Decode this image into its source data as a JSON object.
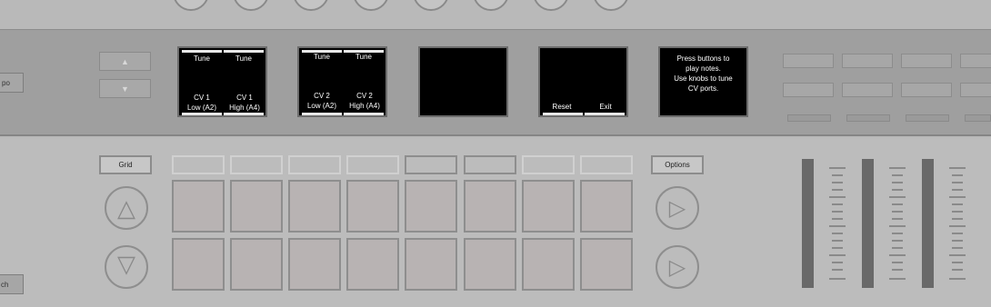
{
  "left_tabs": {
    "tempo": "po",
    "switch": "ch"
  },
  "nav": {
    "up_icon": "▲",
    "down_icon": "▼"
  },
  "screens": [
    {
      "col1_top": "Tune",
      "col2_top": "Tune",
      "col1_bottom_1": "CV 1",
      "col1_bottom_2": "Low (A2)",
      "col2_bottom_1": "CV 1",
      "col2_bottom_2": "High (A4)"
    },
    {
      "col1_top": "Tune",
      "col2_top": "Tune",
      "col1_bottom_1": "CV 2",
      "col1_bottom_2": "Low (A2)",
      "col2_bottom_1": "CV 2",
      "col2_bottom_2": "High (A4)"
    },
    {
      "reset": "Reset",
      "exit": "Exit"
    },
    {
      "help_line_1": "Press buttons to",
      "help_line_2": "play notes.",
      "help_line_3": "Use knobs to tune",
      "help_line_4": "CV ports."
    }
  ],
  "buttons": {
    "grid": "Grid",
    "options": "Options"
  },
  "icons": {
    "triangle_up": "△",
    "play_right": "▷"
  }
}
